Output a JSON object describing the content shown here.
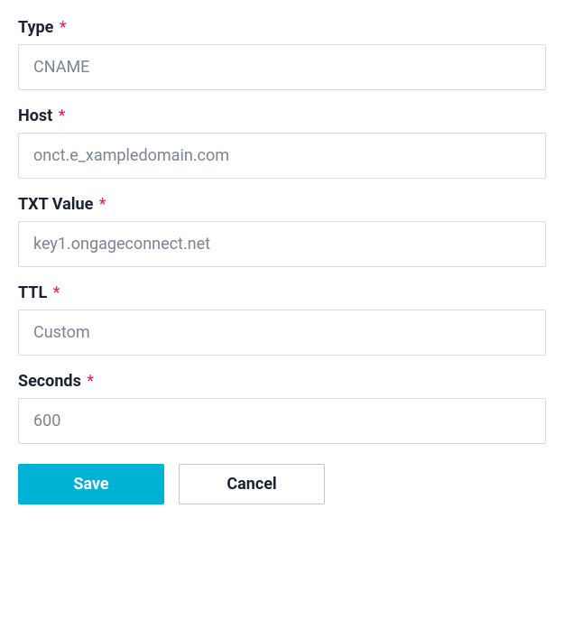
{
  "fields": {
    "type": {
      "label": "Type",
      "value": "CNAME",
      "required": true
    },
    "host": {
      "label": "Host",
      "value": "onct.e_xampledomain.com",
      "required": true
    },
    "txt_value": {
      "label": "TXT Value",
      "value": "key1.ongageconnect.net",
      "required": true
    },
    "ttl": {
      "label": "TTL",
      "value": "Custom",
      "required": true
    },
    "seconds": {
      "label": "Seconds",
      "value": "600",
      "required": true
    }
  },
  "buttons": {
    "save": "Save",
    "cancel": "Cancel"
  },
  "required_symbol": "*"
}
